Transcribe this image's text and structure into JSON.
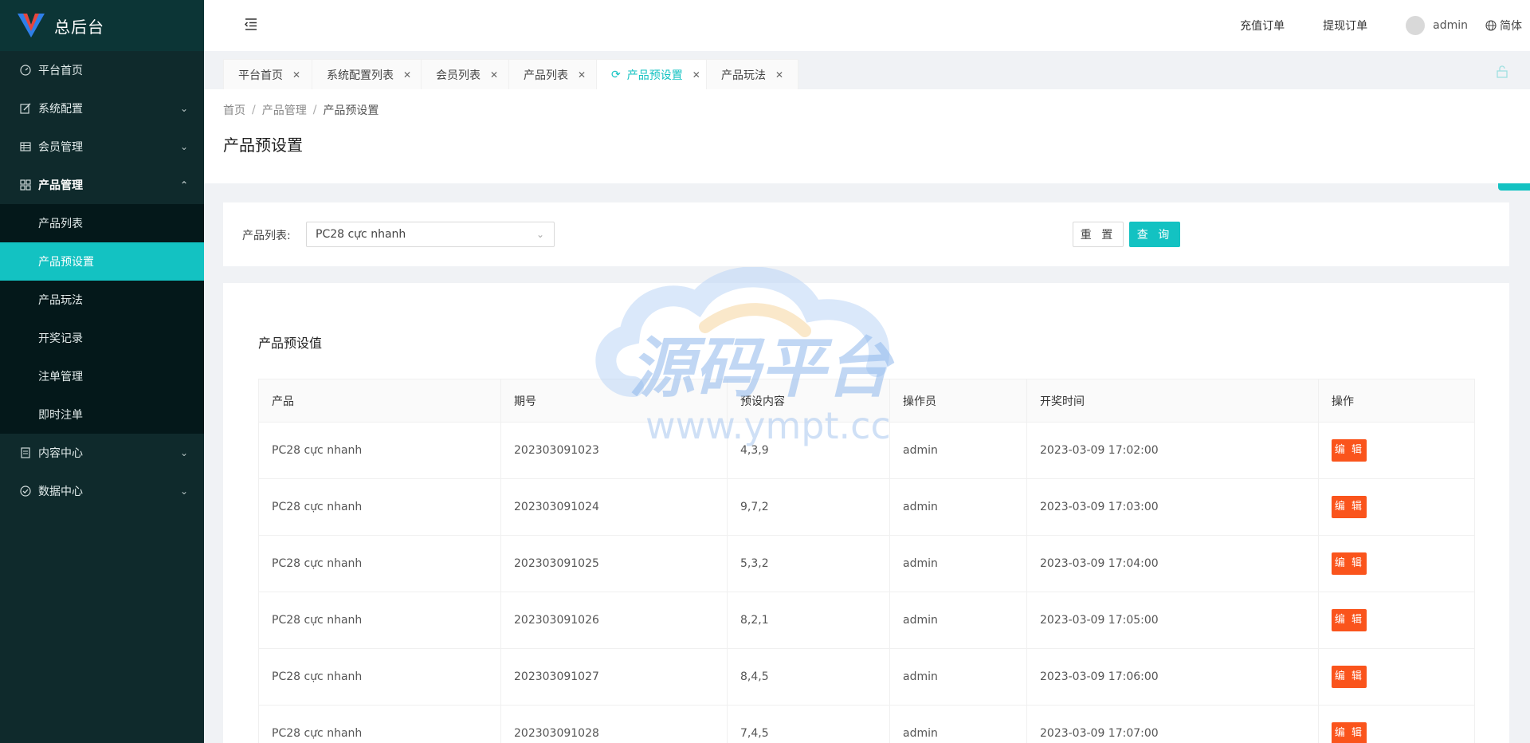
{
  "app": {
    "title": "总后台",
    "accent": "#13c2c2",
    "sidebar_bg": "#0f2a2c"
  },
  "sidebar": {
    "items": [
      {
        "label": "平台首页",
        "icon": "dashboard-icon"
      },
      {
        "label": "系统配置",
        "icon": "edit-icon"
      },
      {
        "label": "会员管理",
        "icon": "table-icon"
      },
      {
        "label": "产品管理",
        "icon": "appstore-icon"
      },
      {
        "label": "内容中心",
        "icon": "file-icon"
      },
      {
        "label": "数据中心",
        "icon": "check-circle-icon"
      }
    ],
    "product_sub": [
      "产品列表",
      "产品预设置",
      "产品玩法",
      "开奖记录",
      "注单管理",
      "即时注单"
    ]
  },
  "header": {
    "recharge_orders": "充值订单",
    "withdraw_orders": "提现订单",
    "username": "admin",
    "language": "简体"
  },
  "tabs": [
    "平台首页",
    "系统配置列表",
    "会员列表",
    "产品列表",
    "产品预设置",
    "产品玩法"
  ],
  "breadcrumb": [
    "首页",
    "产品管理",
    "产品预设置"
  ],
  "page_title": "产品预设置",
  "filter": {
    "label": "产品列表:",
    "selected": "PC28 cực nhanh",
    "reset": "重 置",
    "query": "查 询"
  },
  "card_title": "产品预设值",
  "table": {
    "headers": [
      "产品",
      "期号",
      "预设内容",
      "操作员",
      "开奖时间",
      "操作"
    ],
    "edit_label": "编 辑",
    "rows": [
      [
        "PC28 cực nhanh",
        "202303091023",
        "4,3,9",
        "admin",
        "2023-03-09 17:02:00"
      ],
      [
        "PC28 cực nhanh",
        "202303091024",
        "9,7,2",
        "admin",
        "2023-03-09 17:03:00"
      ],
      [
        "PC28 cực nhanh",
        "202303091025",
        "5,3,2",
        "admin",
        "2023-03-09 17:04:00"
      ],
      [
        "PC28 cực nhanh",
        "202303091026",
        "8,2,1",
        "admin",
        "2023-03-09 17:05:00"
      ],
      [
        "PC28 cực nhanh",
        "202303091027",
        "8,4,5",
        "admin",
        "2023-03-09 17:06:00"
      ],
      [
        "PC28 cực nhanh",
        "202303091028",
        "7,4,5",
        "admin",
        "2023-03-09 17:07:00"
      ]
    ]
  },
  "watermark": {
    "cn": "源码平台",
    "url": "www.ympt.cc"
  }
}
